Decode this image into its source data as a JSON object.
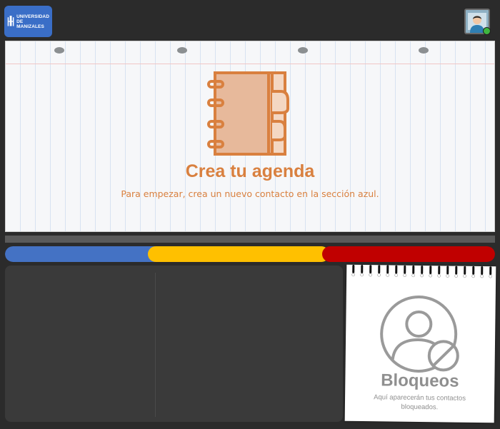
{
  "header": {
    "logo": {
      "line1": "UNIVERSIDAD DE",
      "line2": "MANIZALES",
      "color": "#3a6ec7"
    },
    "avatar": {
      "icon": "user-avatar",
      "status_color": "#3fb63f"
    }
  },
  "agenda": {
    "icon": "notebook-icon",
    "title": "Crea tu agenda",
    "subtitle": "Para empezar, crea un nuevo contacto en la sección azul.",
    "accent_color": "#d9803f"
  },
  "sections": {
    "colors": [
      "#4472c4",
      "#ffc000",
      "#c00000"
    ],
    "names": [
      "blue",
      "yellow",
      "red"
    ]
  },
  "blocked": {
    "icon": "blocked-user-icon",
    "title": "Bloqueos",
    "description": "Aquí aparecerán tus contactos bloqueados."
  }
}
